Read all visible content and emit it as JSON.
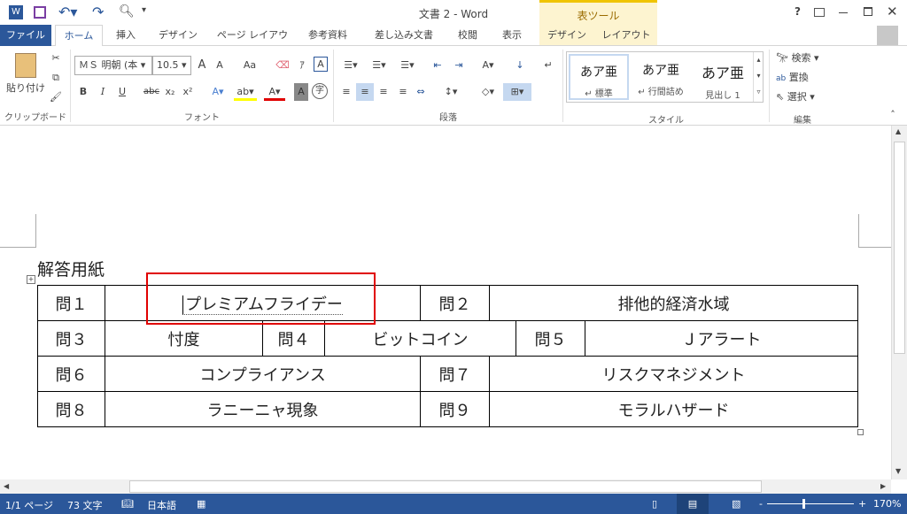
{
  "window": {
    "title": "文書 2 - Word",
    "table_tools": "表ツール"
  },
  "tabs": [
    "ファイル",
    "ホーム",
    "挿入",
    "デザイン",
    "ページ レイアウト",
    "参考資料",
    "差し込み文書",
    "校閲",
    "表示",
    "デザイン",
    "レイアウト"
  ],
  "ribbon": {
    "clipboard": {
      "label": "クリップボード",
      "paste": "貼り付け"
    },
    "font": {
      "label": "フォント",
      "name": "ＭＳ 明朝 (本",
      "size": "10.5",
      "bold": "B",
      "italic": "I",
      "underline": "U",
      "strike": "abc",
      "sub": "x₂",
      "sup": "x²",
      "grow": "A",
      "shrink": "A",
      "case": "Aa"
    },
    "paragraph": {
      "label": "段落"
    },
    "styles": {
      "label": "スタイル",
      "items": [
        {
          "preview": "あア亜",
          "name": "↵ 標準"
        },
        {
          "preview": "あア亜",
          "name": "↵ 行間詰め"
        },
        {
          "preview": "あア亜",
          "name": "見出し 1"
        }
      ]
    },
    "editing": {
      "label": "編集",
      "find": "検索",
      "replace": "置換",
      "select": "選択"
    }
  },
  "document": {
    "heading": "解答用紙",
    "rows": [
      [
        "問１",
        "プレミアムフライデー",
        "問２",
        "排他的経済水域"
      ],
      [
        "問３",
        "忖度",
        "問４",
        "ビットコイン",
        "問５",
        "Ｊアラート"
      ],
      [
        "問６",
        "コンプライアンス",
        "問７",
        "リスクマネジメント"
      ],
      [
        "問８",
        "ラニーニャ現象",
        "問９",
        "モラルハザード"
      ]
    ]
  },
  "status": {
    "page": "1/1 ページ",
    "words": "73 文字",
    "language": "日本語",
    "zoom": "170%",
    "zoom_level_percent": 170
  },
  "colors": {
    "accent": "#2b579a",
    "highlight_box": "#e00000"
  }
}
